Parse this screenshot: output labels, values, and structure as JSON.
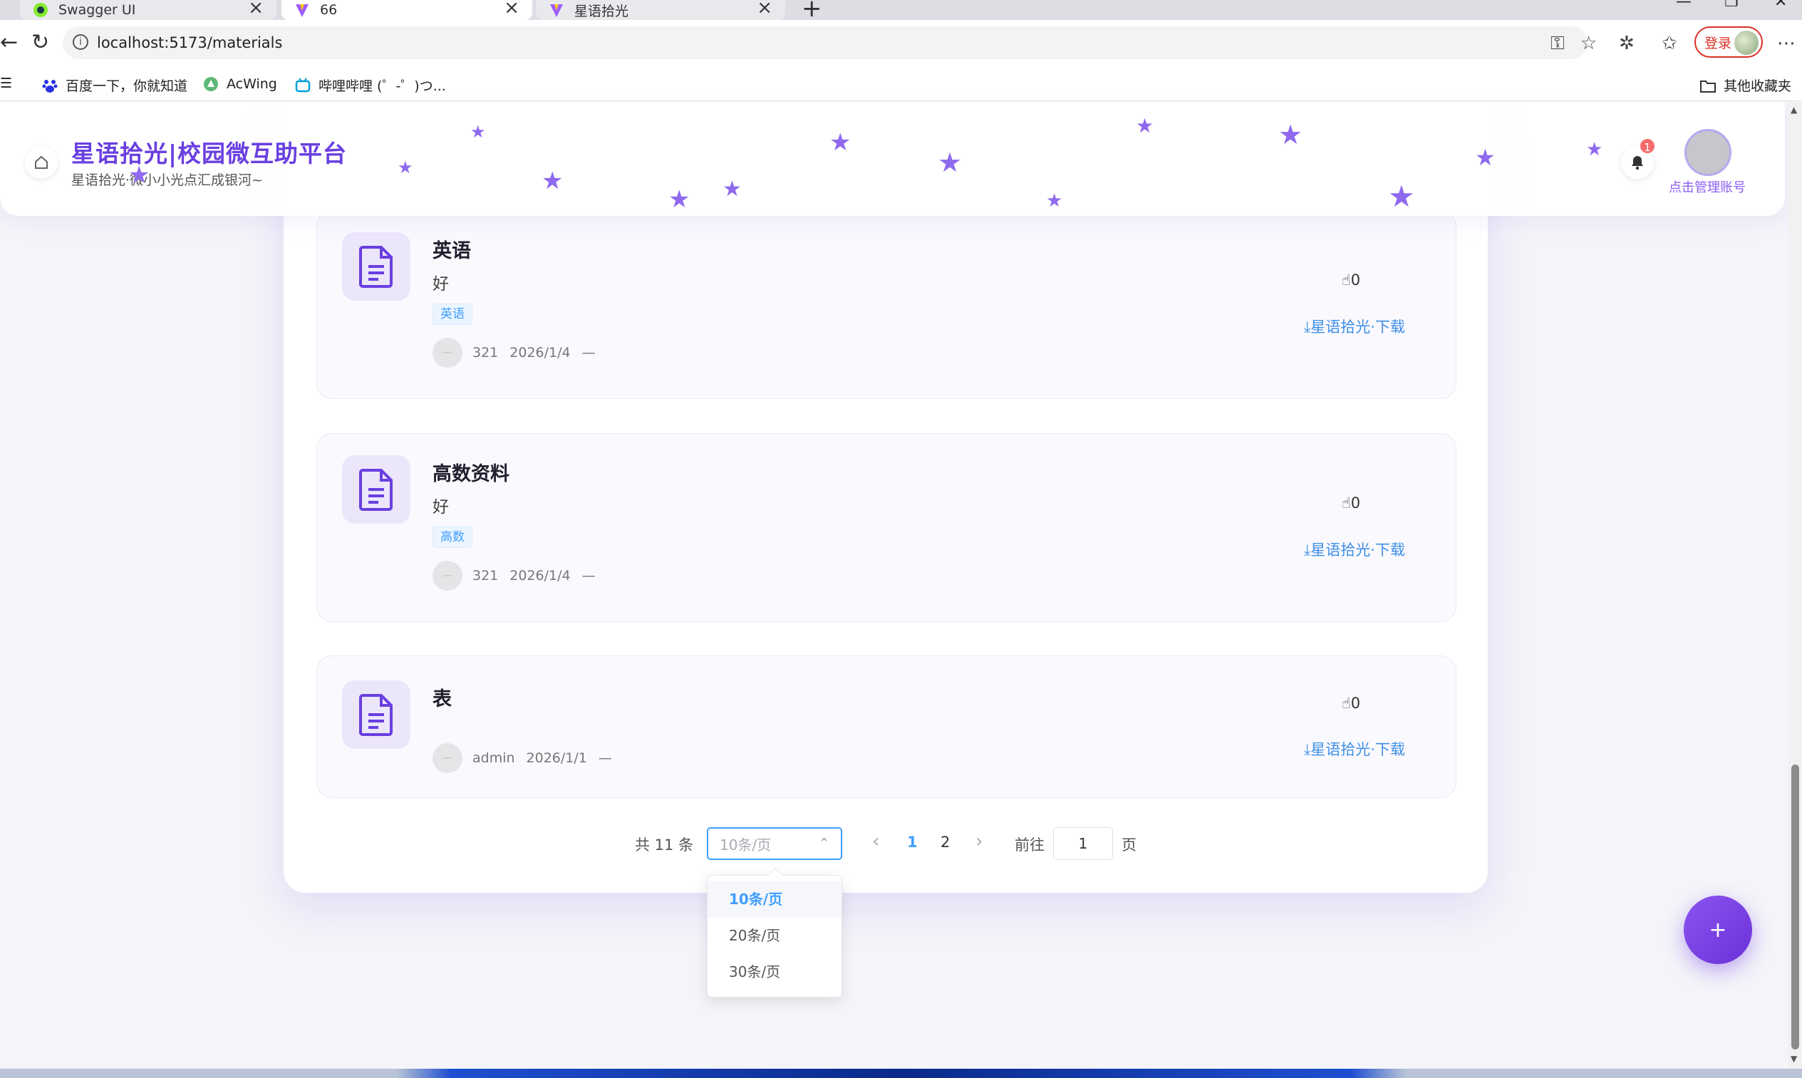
{
  "browser": {
    "tabs": [
      {
        "title": "Swagger UI"
      },
      {
        "title": "66"
      },
      {
        "title": "星语拾光"
      }
    ],
    "new_tab": "+",
    "url": "localhost:5173/materials",
    "login_label": "登录",
    "bookmarks": [
      {
        "label": "百度一下，你就知道"
      },
      {
        "label": "AcWing"
      },
      {
        "label": "哔哩哔哩 (゜-゜)つ..."
      }
    ],
    "other_bookmarks": "其他收藏夹"
  },
  "header": {
    "title": "星语拾光|校园微互助平台",
    "subtitle": "星语拾光·微小小光点汇成银河~",
    "notification_count": "1",
    "manage_account": "点击管理账号"
  },
  "materials": [
    {
      "title": "英语",
      "desc": "好",
      "tag": "英语",
      "author": "321",
      "date": "2026/1/4",
      "extra": "—",
      "likes": "0",
      "download": "星语拾光·下载"
    },
    {
      "title": "高数资料",
      "desc": "好",
      "tag": "高数",
      "author": "321",
      "date": "2026/1/4",
      "extra": "—",
      "likes": "0",
      "download": "星语拾光·下载"
    },
    {
      "title": "表",
      "desc": "",
      "tag": "",
      "author": "admin",
      "date": "2026/1/1",
      "extra": "—",
      "likes": "0",
      "download": "星语拾光·下载"
    }
  ],
  "pagination": {
    "total": "共 11 条",
    "page_size_placeholder": "10条/页",
    "pages": [
      "1",
      "2"
    ],
    "current_page": "1",
    "goto_label": "前往",
    "goto_value": "1",
    "goto_unit": "页",
    "size_options": [
      "10条/页",
      "20条/页",
      "30条/页"
    ],
    "selected_size": "10条/页"
  },
  "fab": {
    "label": "+"
  },
  "colors": {
    "brand": "#6a3fe0",
    "link": "#409eff",
    "star": "#8f69ee"
  }
}
